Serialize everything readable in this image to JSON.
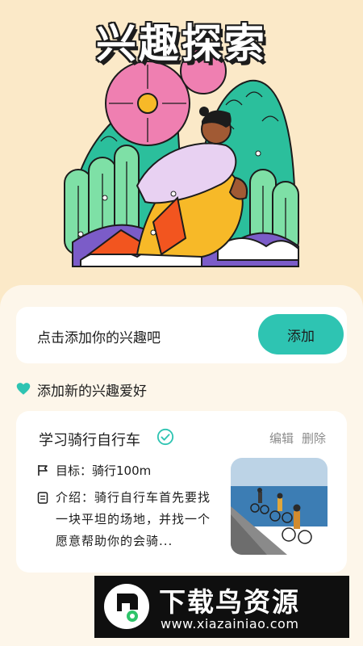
{
  "hero": {
    "title": "兴趣探索"
  },
  "add_interest": {
    "placeholder": "点击添加你的兴趣吧",
    "button_label": "添加"
  },
  "section": {
    "title": "添加新的兴趣爱好"
  },
  "hobby_card": {
    "title": "学习骑行自行车",
    "actions": {
      "edit": "编辑",
      "delete": "删除"
    },
    "goal": "目标：骑行100m",
    "intro": "介绍：骑行自行车首先要找一块平坦的场地，并找一个愿意帮助你的会骑..."
  },
  "watermark": {
    "brand": "下载鸟资源",
    "url": "www.xiazainiao.com"
  },
  "colors": {
    "background": "#fbe9c8",
    "sheet": "#fdf6ea",
    "accent": "#2ec4b2",
    "muted_text": "#8c8c8c"
  },
  "icons": {
    "section": "heart-icon",
    "verified": "check-circle-icon",
    "goal": "flag-icon",
    "intro": "document-icon"
  }
}
